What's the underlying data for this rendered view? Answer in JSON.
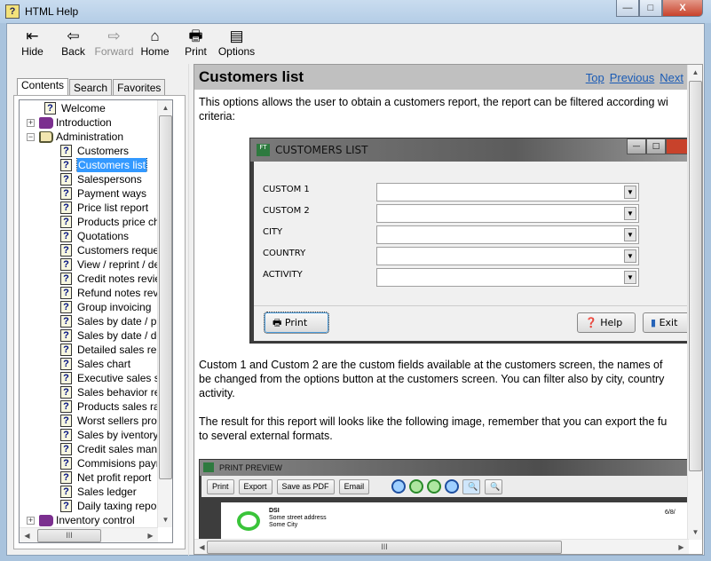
{
  "window": {
    "title": "HTML Help",
    "minimize": "—",
    "maximize": "□",
    "close": "X"
  },
  "toolbar": [
    {
      "label": "Hide",
      "icon": "hide-icon",
      "glyph": "⇤",
      "enabled": true
    },
    {
      "label": "Back",
      "icon": "back-arrow-icon",
      "glyph": "⇦",
      "enabled": true
    },
    {
      "label": "Forward",
      "icon": "forward-arrow-icon",
      "glyph": "⇨",
      "enabled": false
    },
    {
      "label": "Home",
      "icon": "home-icon",
      "glyph": "⌂",
      "enabled": true
    },
    {
      "label": "Print",
      "icon": "printer-icon",
      "glyph": "🖶",
      "enabled": true
    },
    {
      "label": "Options",
      "icon": "options-icon",
      "glyph": "▤",
      "enabled": true
    }
  ],
  "tabs": [
    "Contents",
    "Search",
    "Favorites"
  ],
  "tree": [
    {
      "label": "Welcome",
      "type": "page",
      "level": 1
    },
    {
      "label": "Introduction",
      "type": "book",
      "level": 0,
      "expander": "+"
    },
    {
      "label": "Administration",
      "type": "book-open",
      "level": 0,
      "expander": "−"
    },
    {
      "label": "Customers",
      "type": "page",
      "level": 2
    },
    {
      "label": "Customers list",
      "type": "page",
      "level": 2,
      "selected": true
    },
    {
      "label": "Salespersons",
      "type": "page",
      "level": 2
    },
    {
      "label": "Payment ways",
      "type": "page",
      "level": 2
    },
    {
      "label": "Price list report",
      "type": "page",
      "level": 2
    },
    {
      "label": "Products price char",
      "type": "page",
      "level": 2
    },
    {
      "label": "Quotations",
      "type": "page",
      "level": 2
    },
    {
      "label": "Customers requests",
      "type": "page",
      "level": 2
    },
    {
      "label": "View / reprint / dele",
      "type": "page",
      "level": 2
    },
    {
      "label": "Credit notes review",
      "type": "page",
      "level": 2
    },
    {
      "label": "Refund notes revie",
      "type": "page",
      "level": 2
    },
    {
      "label": "Group invoicing",
      "type": "page",
      "level": 2
    },
    {
      "label": "Sales by date / pro",
      "type": "page",
      "level": 2
    },
    {
      "label": "Sales by date / doc",
      "type": "page",
      "level": 2
    },
    {
      "label": "Detailed sales repo",
      "type": "page",
      "level": 2
    },
    {
      "label": "Sales chart",
      "type": "page",
      "level": 2
    },
    {
      "label": "Executive sales sur",
      "type": "page",
      "level": 2
    },
    {
      "label": "Sales behavior repo",
      "type": "page",
      "level": 2
    },
    {
      "label": "Products sales rank",
      "type": "page",
      "level": 2
    },
    {
      "label": "Worst sellers produ",
      "type": "page",
      "level": 2
    },
    {
      "label": "Sales by iventory st",
      "type": "page",
      "level": 2
    },
    {
      "label": "Credit sales manag",
      "type": "page",
      "level": 2
    },
    {
      "label": "Commisions paymer",
      "type": "page",
      "level": 2
    },
    {
      "label": "Net profit report",
      "type": "page",
      "level": 2
    },
    {
      "label": "Sales ledger",
      "type": "page",
      "level": 2
    },
    {
      "label": "Daily taxing report",
      "type": "page",
      "level": 2
    },
    {
      "label": "Inventory control",
      "type": "book",
      "level": 0,
      "expander": "+"
    }
  ],
  "content": {
    "title": "Customers list",
    "nav": [
      "Top",
      "Previous",
      "Next"
    ],
    "p1": [
      "This options allows the user to obtain a customers report, the report can be filtered according wi",
      "criteria:"
    ],
    "p2": [
      "Custom 1 and Custom 2 are the custom fields available at the customers screen, the names of",
      "be changed from the options button at the customers screen. You can filter also by city, country",
      "activity."
    ],
    "p3": [
      "The result for this report will looks like the following image, remember that you can export the fu",
      "to several external formats."
    ]
  },
  "dialog": {
    "logo": "FT",
    "title": "CUSTOMERS LIST",
    "fields": [
      {
        "label": "CUSTOM 1",
        "value": ""
      },
      {
        "label": "CUSTOM 2",
        "value": ""
      },
      {
        "label": "CITY",
        "value": ""
      },
      {
        "label": "COUNTRY",
        "value": ""
      },
      {
        "label": "ACTIVITY",
        "value": ""
      }
    ],
    "print": "Print",
    "help": "Help",
    "exit": "Exit"
  },
  "preview": {
    "title": "PRINT PREVIEW",
    "buttons": [
      "Print",
      "Export",
      "Save as PDF",
      "Email"
    ],
    "company": "DSI",
    "address": "Some street address",
    "city": "Some City",
    "date": "6/8/"
  }
}
